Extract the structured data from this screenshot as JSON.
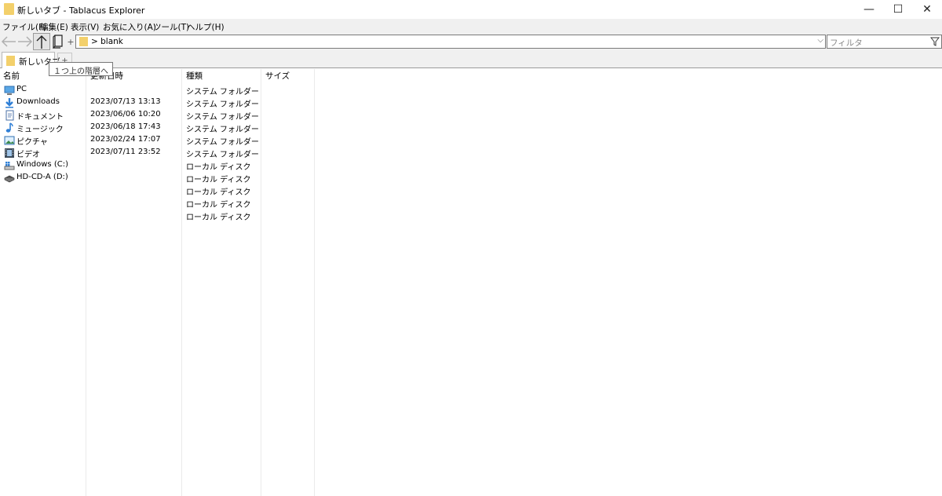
{
  "window": {
    "title": "新しいタブ - Tablacus Explorer",
    "minimize_glyph": "—",
    "maximize_glyph": "☐",
    "close_glyph": "✕"
  },
  "menu": [
    {
      "label": "ファイル(F)"
    },
    {
      "label": "編集(E)"
    },
    {
      "label": "表示(V)"
    },
    {
      "label": "お気に入り(A)"
    },
    {
      "label": "ツール(T)"
    },
    {
      "label": "ヘルプ(H)"
    }
  ],
  "toolbar": {
    "add_glyph": "+",
    "address_text": "> blank",
    "address_dropdown": "⌵",
    "filter_placeholder": "フィルタ"
  },
  "tabs": {
    "active_label": "新しいタブ",
    "new_tab_glyph": "+"
  },
  "tooltip": "１つ上の階層へ",
  "columns": [
    "名前",
    "更新日時",
    "種類",
    "サイズ"
  ],
  "rows": [
    {
      "name": "PC",
      "icon": "pc-icon",
      "date": "",
      "type": "システム フォルダー"
    },
    {
      "name": "Downloads",
      "icon": "downloads-icon",
      "date": "2023/07/13 13:13",
      "type": "システム フォルダー"
    },
    {
      "name": "ドキュメント",
      "icon": "document-icon",
      "date": "2023/06/06 10:20",
      "type": "システム フォルダー"
    },
    {
      "name": "ミュージック",
      "icon": "music-icon",
      "date": "2023/06/18 17:43",
      "type": "システム フォルダー"
    },
    {
      "name": "ピクチャ",
      "icon": "picture-icon",
      "date": "2023/02/24 17:07",
      "type": "システム フォルダー"
    },
    {
      "name": "ビデオ",
      "icon": "video-icon",
      "date": "2023/07/11 23:52",
      "type": "システム フォルダー"
    },
    {
      "name": "Windows (C:)",
      "icon": "windows-drive-icon",
      "date": "",
      "type": "ローカル ディスク"
    },
    {
      "name": "HD-CD-A (D:)",
      "icon": "hard-disk-icon",
      "date": "",
      "type": "ローカル ディスク"
    },
    {
      "name": "",
      "icon": "",
      "date": "",
      "type": "ローカル ディスク"
    },
    {
      "name": "",
      "icon": "",
      "date": "",
      "type": "ローカル ディスク"
    },
    {
      "name": "",
      "icon": "",
      "date": "",
      "type": "ローカル ディスク"
    }
  ],
  "colors": {
    "folder": "#f3d06b",
    "accent_blue": "#2f7fd6"
  }
}
